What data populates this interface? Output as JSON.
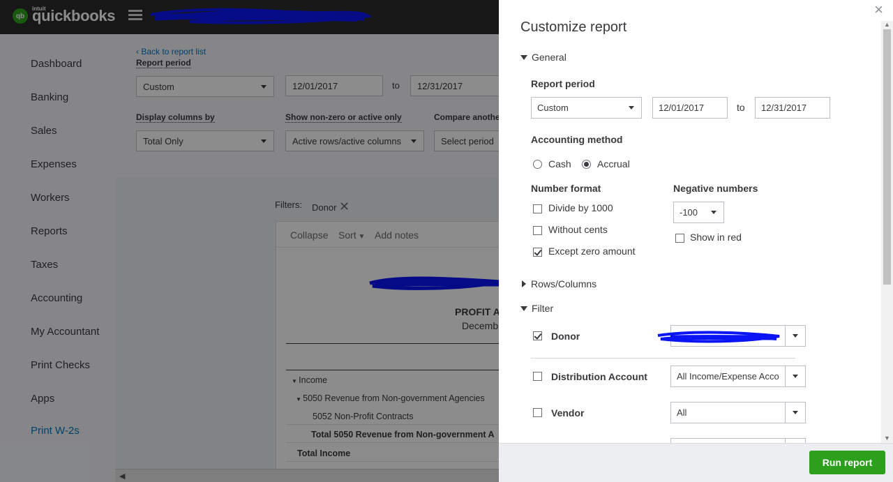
{
  "app": {
    "brand_small": "intuit",
    "brand": "quickbooks",
    "logo_badge": "qb"
  },
  "sidebar": {
    "items": [
      {
        "label": "Dashboard"
      },
      {
        "label": "Banking"
      },
      {
        "label": "Sales"
      },
      {
        "label": "Expenses"
      },
      {
        "label": "Workers"
      },
      {
        "label": "Reports"
      },
      {
        "label": "Taxes"
      },
      {
        "label": "Accounting"
      },
      {
        "label": "My Accountant"
      },
      {
        "label": "Print Checks"
      },
      {
        "label": "Apps"
      },
      {
        "label": "Print W-2s"
      }
    ]
  },
  "report_toolbar": {
    "back_link": "Back to report list",
    "report_period_label": "Report period",
    "report_period_value": "Custom",
    "from_date": "12/01/2017",
    "to_label": "to",
    "to_date": "12/31/2017",
    "display_columns_label": "Display columns by",
    "display_columns_value": "Total Only",
    "show_nonzero_label": "Show non-zero or active only",
    "show_nonzero_value": "Active rows/active columns",
    "compare_label": "Compare anothe",
    "compare_value": "Select period"
  },
  "report": {
    "filters_label": "Filters:",
    "filter_chip": "Donor",
    "collapse": "Collapse",
    "sort": "Sort",
    "add_notes": "Add notes",
    "title": "PROFIT A",
    "subtitle": "Decemb",
    "rows": [
      {
        "label": "Income"
      },
      {
        "label": "5050 Revenue from Non-government Agencies"
      },
      {
        "label": "5052 Non-Profit Contracts"
      },
      {
        "label": "Total 5050 Revenue from Non-government A"
      },
      {
        "label": "Total Income"
      }
    ]
  },
  "panel": {
    "title": "Customize report",
    "close": "×",
    "general": {
      "heading": "General",
      "report_period_label": "Report period",
      "report_period_value": "Custom",
      "from_date": "12/01/2017",
      "to_label": "to",
      "to_date": "12/31/2017",
      "accounting_method_label": "Accounting method",
      "cash_label": "Cash",
      "accrual_label": "Accrual",
      "selected_method": "Accrual",
      "number_format_label": "Number format",
      "divide_label": "Divide by 1000",
      "divide_checked": false,
      "without_cents_label": "Without cents",
      "without_cents_checked": false,
      "except_zero_label": "Except zero amount",
      "except_zero_checked": true,
      "negative_numbers_label": "Negative numbers",
      "negative_value": "-100",
      "show_in_red_label": "Show in red",
      "show_in_red_checked": false
    },
    "rows_columns": {
      "heading": "Rows/Columns"
    },
    "filter": {
      "heading": "Filter",
      "donor_label": "Donor",
      "donor_checked": true,
      "distribution_label": "Distribution Account",
      "distribution_checked": false,
      "distribution_value": "All Income/Expense Acco",
      "vendor_label": "Vendor",
      "vendor_checked": false,
      "vendor_value": "All"
    },
    "run_report": "Run report"
  },
  "colors": {
    "brand_green": "#2ca01c",
    "link_blue": "#0077c5",
    "redaction_blue": "#0a14f5",
    "topbar": "#2b2b2b"
  }
}
